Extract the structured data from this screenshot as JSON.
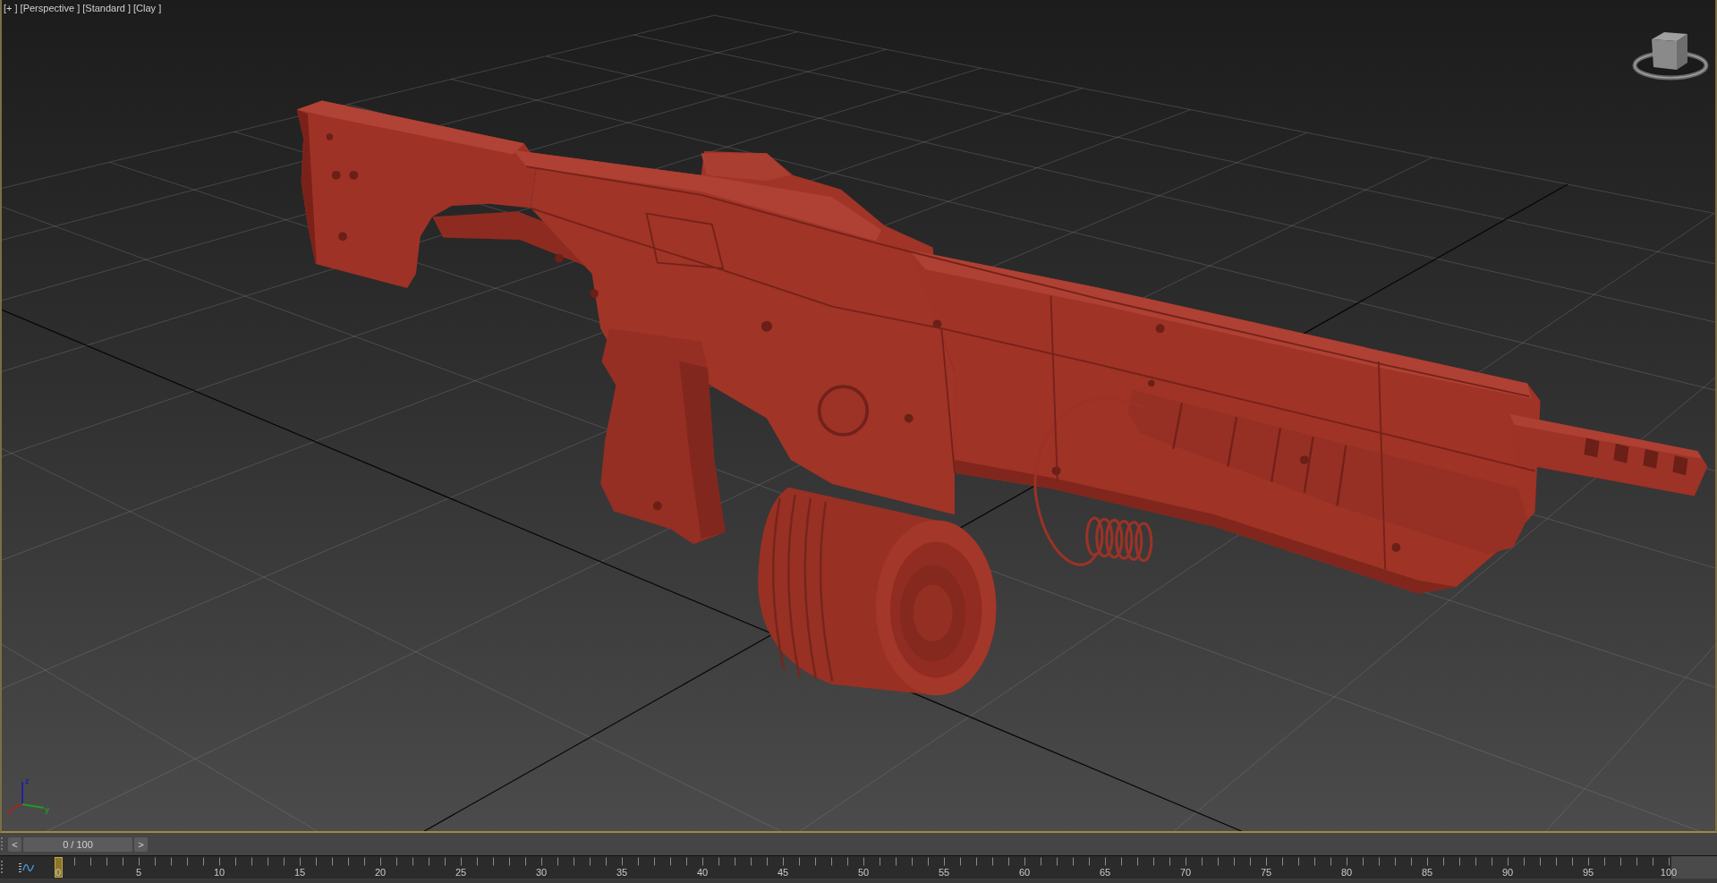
{
  "viewport": {
    "labels": [
      "[+ ]",
      "[Perspective ]",
      "[Standard ]",
      "[Clay ]"
    ],
    "axes": [
      {
        "label": "z",
        "color": "#1e1ea6"
      },
      {
        "label": "x",
        "color": "#b02222"
      },
      {
        "label": "y",
        "color": "#1f9a26"
      }
    ]
  },
  "time_slider": {
    "previous": "<",
    "reading": "0 / 100",
    "next": ">",
    "level": 0
  },
  "track_bar": {
    "frame_labels": [
      "0",
      "5",
      "10",
      "15",
      "20",
      "25",
      "30",
      "35",
      "40",
      "45",
      "50",
      "55",
      "60",
      "65",
      "70",
      "75",
      "80",
      "85",
      "90",
      "95",
      "100"
    ]
  }
}
